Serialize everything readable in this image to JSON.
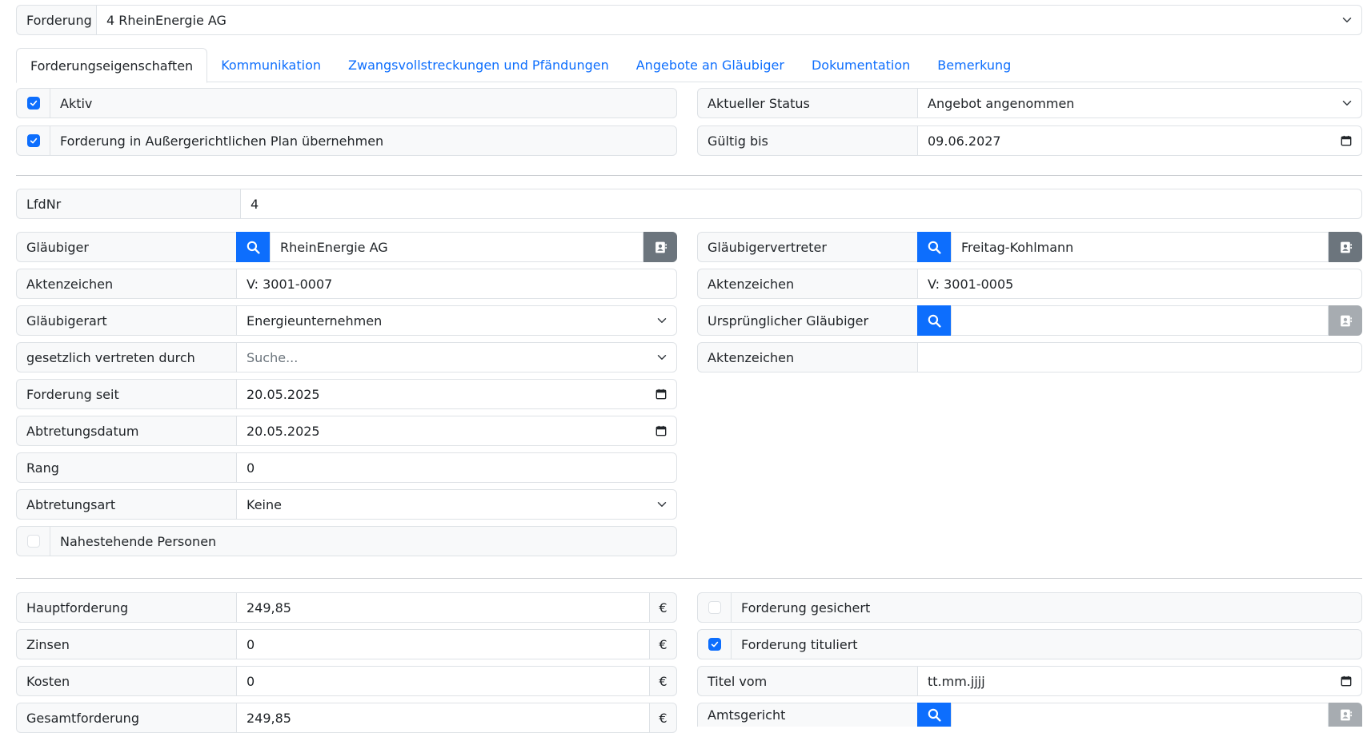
{
  "forderung": {
    "label": "Forderung",
    "value": "4 RheinEnergie AG"
  },
  "tabs": [
    {
      "label": "Forderungseigenschaften"
    },
    {
      "label": "Kommunikation"
    },
    {
      "label": "Zwangsvollstreckungen und Pfändungen"
    },
    {
      "label": "Angebote an Gläubiger"
    },
    {
      "label": "Dokumentation"
    },
    {
      "label": "Bemerkung"
    }
  ],
  "general": {
    "aktiv": {
      "label": "Aktiv",
      "checked": true
    },
    "plan": {
      "label": "Forderung in Außergerichtlichen Plan übernehmen",
      "checked": true
    },
    "status": {
      "label": "Aktueller Status",
      "value": "Angebot angenommen"
    },
    "gueltig": {
      "label": "Gültig bis",
      "value": "09.06.2027"
    }
  },
  "lfdnr": {
    "label": "LfdNr",
    "value": "4"
  },
  "creditor": {
    "glaeubiger": {
      "label": "Gläubiger",
      "value": "RheinEnergie AG"
    },
    "aktenzeichen": {
      "label": "Aktenzeichen",
      "value": "V: 3001-0007"
    },
    "art": {
      "label": "Gläubigerart",
      "value": "Energieunternehmen"
    },
    "vertreten": {
      "label": "gesetzlich vertreten durch",
      "placeholder": "Suche..."
    },
    "seit": {
      "label": "Forderung seit",
      "value": "20.05.2025"
    },
    "abtretungsdatum": {
      "label": "Abtretungsdatum",
      "value": "20.05.2025"
    },
    "rang": {
      "label": "Rang",
      "value": "0"
    },
    "abtretungsart": {
      "label": "Abtretungsart",
      "value": "Keine"
    },
    "nahestehende": {
      "label": "Nahestehende Personen",
      "checked": false
    }
  },
  "representative": {
    "vertreter": {
      "label": "Gläubigervertreter",
      "value": "Freitag-Kohlmann"
    },
    "aktenzeichen": {
      "label": "Aktenzeichen",
      "value": "V: 3001-0005"
    },
    "urspruenglich": {
      "label": "Ursprünglicher Gläubiger",
      "value": ""
    },
    "aktenzeichen2": {
      "label": "Aktenzeichen",
      "value": ""
    }
  },
  "amounts": {
    "currency": "€",
    "haupt": {
      "label": "Hauptforderung",
      "value": "249,85"
    },
    "zinsen": {
      "label": "Zinsen",
      "value": "0"
    },
    "kosten": {
      "label": "Kosten",
      "value": "0"
    },
    "gesamt": {
      "label": "Gesamtforderung",
      "value": "249,85"
    }
  },
  "title": {
    "gesichert": {
      "label": "Forderung gesichert",
      "checked": false
    },
    "tituliert": {
      "label": "Forderung tituliert",
      "checked": true
    },
    "titel_vom": {
      "label": "Titel vom",
      "value": "tt.mm.jjjj"
    },
    "amtsgericht": {
      "label": "Amtsgericht",
      "value": ""
    }
  },
  "colors": {
    "primary": "#0d6efd",
    "secondary": "#6c757d",
    "border": "#dee2e6",
    "label_bg": "#f8f9fa"
  }
}
